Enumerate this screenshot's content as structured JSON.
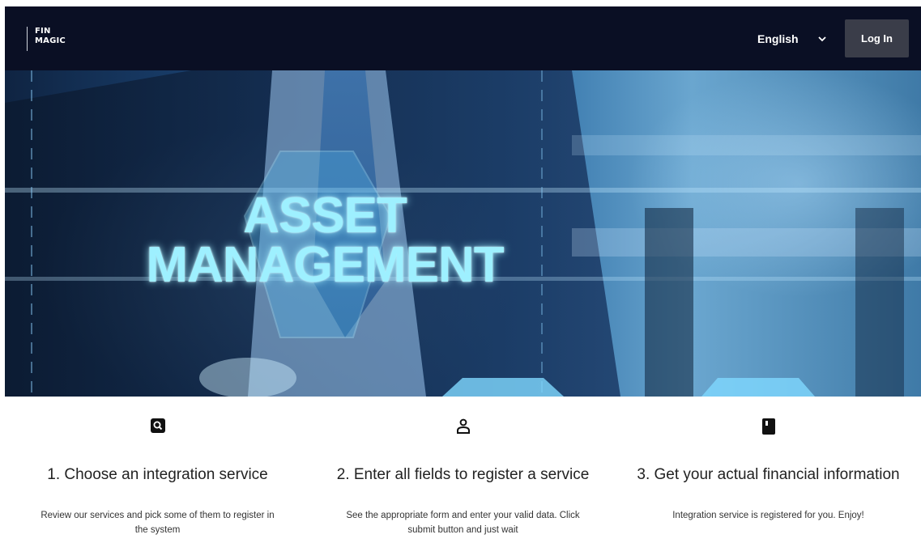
{
  "header": {
    "logo_line1": "FIN",
    "logo_line2": "MAGIC",
    "language": "English",
    "login_label": "Log In"
  },
  "hero": {
    "title_line1": "ASSET",
    "title_line2": "MANAGEMENT"
  },
  "steps": [
    {
      "icon": "search-icon",
      "title": "1. Choose an integration service",
      "text": "Review our services and pick some of them to register in the system"
    },
    {
      "icon": "user-icon",
      "title": "2. Enter all fields to register a service",
      "text": "See the appropriate form and enter your valid data. Click submit button and just wait"
    },
    {
      "icon": "book-icon",
      "title": "3. Get your actual financial information",
      "text": "Integration service is registered for you. Enjoy!"
    }
  ]
}
